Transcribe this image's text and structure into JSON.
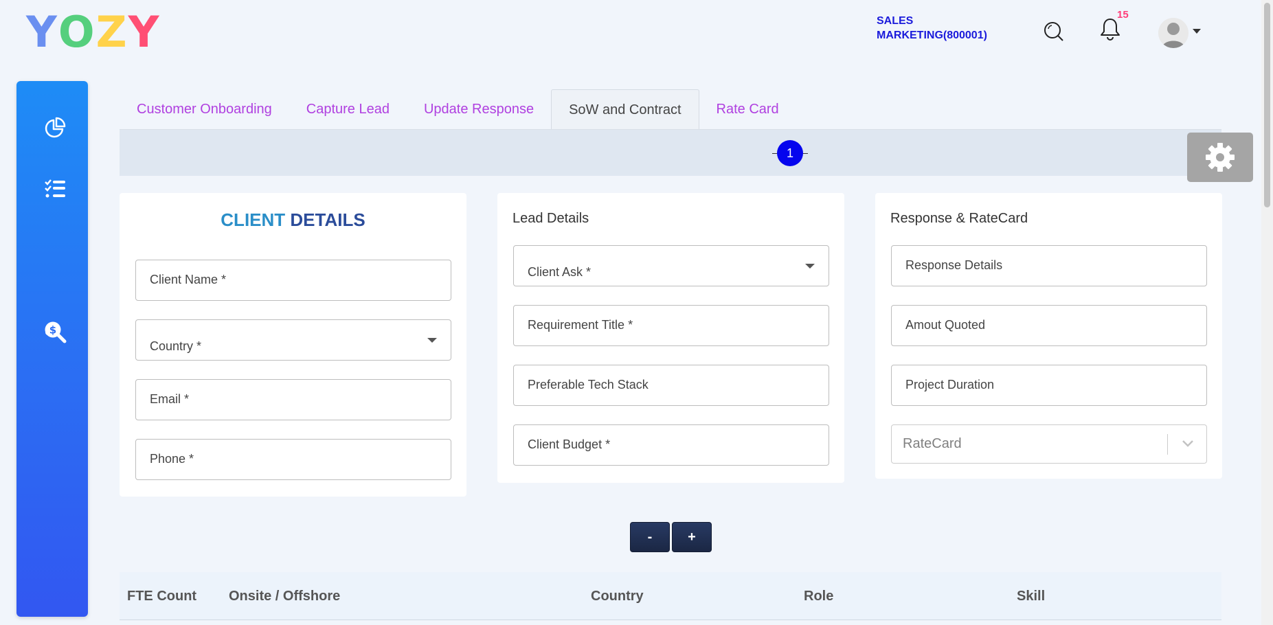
{
  "header": {
    "logo_letters": [
      "Y",
      "O",
      "Z",
      "Y"
    ],
    "logo_colors": [
      "#6a8ff0",
      "#55cf7d",
      "#ffd24a",
      "#ff4f74"
    ],
    "department_line1": "SALES",
    "department_line2": "MARKETING(800001)",
    "notification_count": "15",
    "icons": [
      "search-icon",
      "bell-icon",
      "avatar",
      "chevron-down-icon"
    ]
  },
  "sidebar": {
    "items": [
      {
        "icon": "pie-chart-icon"
      },
      {
        "icon": "checklist-icon"
      },
      {
        "icon": "search-dollar-icon",
        "active": true
      }
    ]
  },
  "tabs": [
    {
      "label": "Customer Onboarding"
    },
    {
      "label": "Capture Lead"
    },
    {
      "label": "Update Response"
    },
    {
      "label": "SoW and Contract",
      "active": true
    },
    {
      "label": "Rate Card"
    }
  ],
  "stepper": {
    "current_step": "1"
  },
  "client_details": {
    "title_part1": "CLIENT",
    "title_part2": "DETAILS",
    "fields": {
      "client_name": "Client Name *",
      "country": "Country *",
      "email": "Email *",
      "phone": "Phone *"
    }
  },
  "lead_details": {
    "title": "Lead Details",
    "fields": {
      "client_ask": "Client Ask *",
      "requirement_title": "Requirement Title *",
      "tech_stack": "Preferable Tech Stack",
      "client_budget": "Client Budget *"
    }
  },
  "response_ratecard": {
    "title": "Response & RateCard",
    "fields": {
      "response_details": "Response Details",
      "amount_quoted": "Amout Quoted",
      "project_duration": "Project Duration",
      "ratecard_placeholder": "RateCard"
    }
  },
  "actions": {
    "minus_label": "-",
    "plus_label": "+"
  },
  "table": {
    "headers": [
      "FTE Count",
      "Onsite / Offshore",
      "Country",
      "Role",
      "Skill"
    ]
  },
  "colors": {
    "tab_link": "#b040e0",
    "step_circle": "#0505ee",
    "department_text": "#1a1adb",
    "badge": "#ff3d7a",
    "sidebar_top": "#1e8cf6",
    "sidebar_bottom": "#3257f1"
  }
}
